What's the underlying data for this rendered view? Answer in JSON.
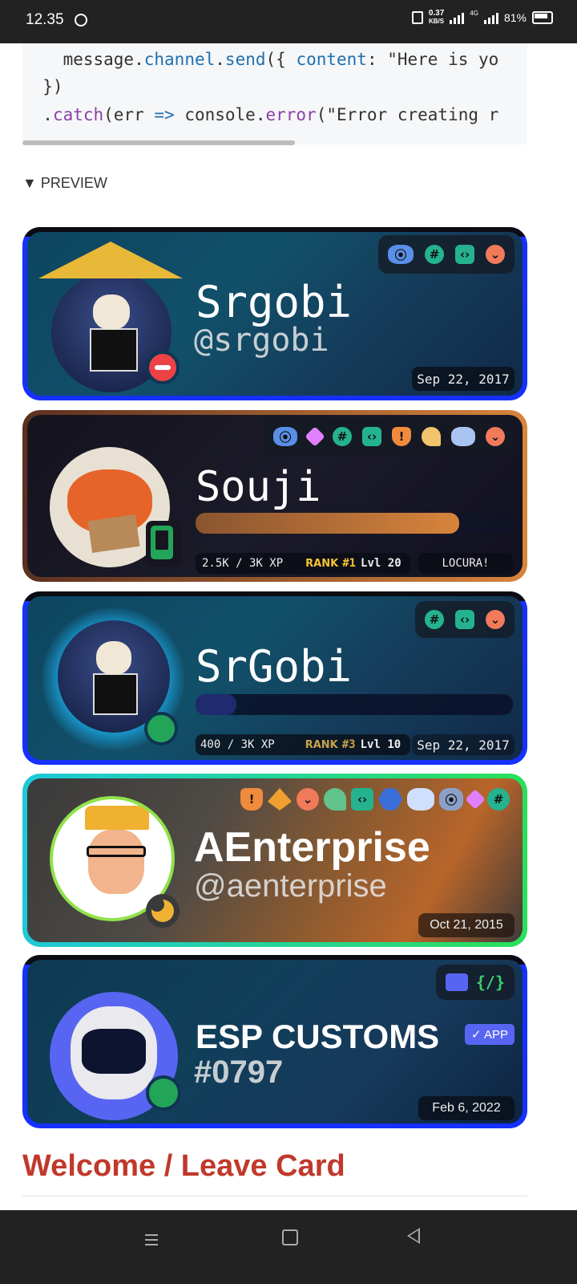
{
  "status_bar": {
    "time": "12.35",
    "net_speed_value": "0.37",
    "net_speed_unit": "KB/S",
    "network_type": "4G",
    "battery": "81%"
  },
  "code": {
    "line1_indent": "    ",
    "line1_obj": "message",
    "line1_prop": "channel",
    "line1_method": "send",
    "line1_open": "({ ",
    "line1_key": "content",
    "line1_rest": ": \"Here is yo",
    "line2": "  })",
    "line3_dot": "  .",
    "line3_catch": "catch",
    "line3_args": "(err ",
    "line3_arrow": "=>",
    "line3_console": " console.",
    "line3_error": "error",
    "line3_rest": "(\"Error creating r"
  },
  "preview_label": "▼ PREVIEW",
  "cards": [
    {
      "name": "Srgobi",
      "handle": "@srgobi",
      "date": "Sep 22, 2017",
      "status": "dnd",
      "badges": [
        "hypesquad-icon",
        "channel-icon",
        "code-icon",
        "chevron-icon"
      ]
    },
    {
      "name": "Souji",
      "xp": "2.5K / 3K XP",
      "rank_label": "RANK",
      "rank": "#1",
      "level": "Lvl 20",
      "tag": "LOCURA!",
      "status": "mobile",
      "xp_progress": 0.83,
      "badges": [
        "hypesquad-icon",
        "nitro-gem-icon",
        "channel-icon",
        "code-icon",
        "shield-icon",
        "bughunter-icon",
        "nitro-icon",
        "chevron-icon"
      ]
    },
    {
      "name": "SrGobi",
      "xp": "400 / 3K XP",
      "rank_label": "RANK",
      "rank": "#3",
      "level": "Lvl 10",
      "date": "Sep 22, 2017",
      "status": "online",
      "xp_progress": 0.13,
      "badges": [
        "channel-icon",
        "code-icon",
        "chevron-icon"
      ]
    },
    {
      "name": "AEnterprise",
      "handle": "@aenterprise",
      "date": "Oct 21, 2015",
      "status": "idle",
      "badges": [
        "shield-icon",
        "chevrons-icon",
        "chevron-icon",
        "bughunter-icon",
        "code-icon",
        "developer-icon",
        "nitro-icon",
        "hypesquad-icon",
        "nitro-gem-icon",
        "channel-icon"
      ]
    },
    {
      "name": "ESP CUSTOMS",
      "discriminator": "#0797",
      "app_label": "✓ APP",
      "date": "Feb 6, 2022",
      "status": "online",
      "badges": [
        "robot-icon",
        "slash-commands-icon"
      ],
      "slash_text": "{/}"
    }
  ],
  "section_title": "Welcome / Leave Card"
}
